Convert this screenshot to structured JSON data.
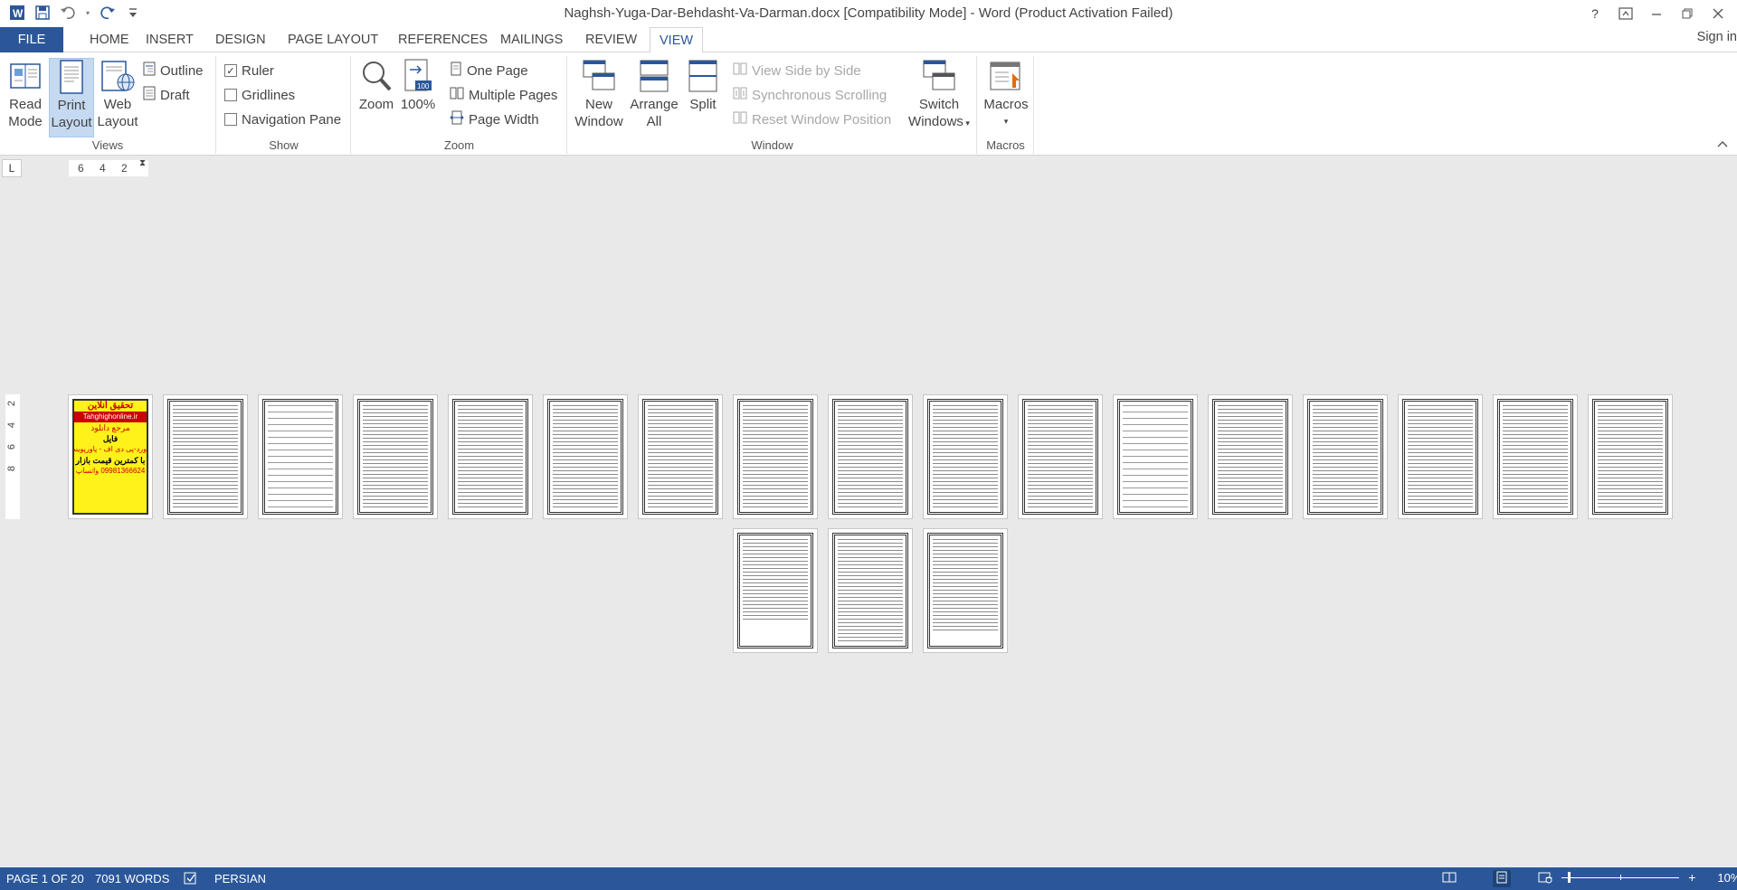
{
  "title": {
    "document": "Naghsh-Yuga-Dar-Behdasht-Va-Darman.docx [Compatibility Mode] - Word (Product Activation Failed)"
  },
  "window_controls": {
    "help": "?"
  },
  "tabs": [
    "FILE",
    "HOME",
    "INSERT",
    "DESIGN",
    "PAGE LAYOUT",
    "REFERENCES",
    "MAILINGS",
    "REVIEW",
    "VIEW"
  ],
  "active_tab": "VIEW",
  "signin": "Sign in",
  "ribbon": {
    "views": {
      "label": "Views",
      "read_mode": [
        "Read",
        "Mode"
      ],
      "print_layout": [
        "Print",
        "Layout"
      ],
      "web_layout": [
        "Web",
        "Layout"
      ],
      "outline": "Outline",
      "draft": "Draft"
    },
    "show": {
      "label": "Show",
      "ruler": {
        "text": "Ruler",
        "checked": true
      },
      "gridlines": {
        "text": "Gridlines",
        "checked": false
      },
      "navigation_pane": {
        "text": "Navigation Pane",
        "checked": false
      }
    },
    "zoom": {
      "label": "Zoom",
      "zoom": "Zoom",
      "hundred": "100%",
      "one_page": "One Page",
      "multiple_pages": "Multiple Pages",
      "page_width": "Page Width"
    },
    "window": {
      "label": "Window",
      "new_window": [
        "New",
        "Window"
      ],
      "arrange_all": [
        "Arrange",
        "All"
      ],
      "split": "Split",
      "side_by_side": "View Side by Side",
      "sync_scroll": "Synchronous Scrolling",
      "reset_pos": "Reset Window Position",
      "switch_windows": [
        "Switch",
        "Windows"
      ]
    },
    "macros": {
      "label": "Macros",
      "macros": "Macros"
    }
  },
  "ruler": {
    "corner": "L",
    "h_ticks": [
      "6",
      "4",
      "2"
    ],
    "v_ticks": [
      "2",
      "4",
      "6",
      "8"
    ]
  },
  "cover_ad": {
    "lines": [
      "تحقیق آنلاین",
      "Tahghighonline.ir",
      "مرجع دانلود",
      "فایل",
      "ورد-پی دی اف - پاورپوینت",
      "با کمترین قیمت بازار",
      "09981366624 واتساپ"
    ]
  },
  "status": {
    "page": "PAGE 1 OF 20",
    "words": "7091 WORDS",
    "language": "PERSIAN",
    "zoom": "10%"
  },
  "colors": {
    "accent": "#2b579a",
    "ad_background": "#fff21a"
  }
}
